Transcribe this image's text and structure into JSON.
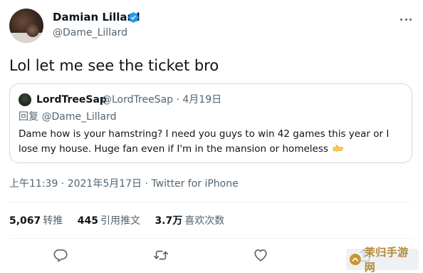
{
  "author": {
    "display_name": "Damian Lillard",
    "handle": "@Dame_Lillard",
    "verified": true
  },
  "tweet": {
    "text": "Lol let me see the ticket bro"
  },
  "quoted_tweet": {
    "author_name": "LordTreeSap",
    "handle_date": "@LordTreeSap · 4月19日",
    "reply_prefix": "回复",
    "reply_mention": "@Dame_Lillard",
    "text": "Dame how is your hamstring? I need you guys to win 42 games this year or I lose my house. Huge fan even if I'm in the mansion or homeless",
    "emoji": "hand-icon"
  },
  "meta": {
    "time_date": "上午11:39 · 2021年5月17日 · ",
    "source": "Twitter for iPhone"
  },
  "stats": {
    "retweets_value": "5,067",
    "retweets_label": "转推",
    "quotes_value": "445",
    "quotes_label": "引用推文",
    "likes_value": "3.7万",
    "likes_label": "喜欢次数"
  },
  "actions": {
    "icons": [
      "reply-icon",
      "retweet-icon",
      "like-icon",
      "share-icon"
    ]
  },
  "colors": {
    "text": "#0f1419",
    "secondary": "#536471",
    "border": "#cfd9de",
    "verified": "#1d9bf0"
  }
}
